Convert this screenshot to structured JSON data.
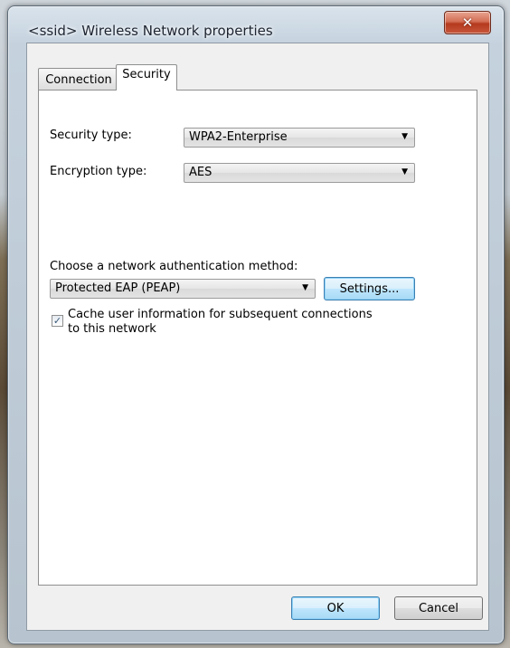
{
  "window": {
    "title": "<ssid> Wireless Network properties",
    "close_icon": "close-icon"
  },
  "tabs": [
    {
      "label": "Connection",
      "selected": false
    },
    {
      "label": "Security",
      "selected": true
    }
  ],
  "security": {
    "security_type_label": "Security type:",
    "security_type_value": "WPA2-Enterprise",
    "encryption_type_label": "Encryption type:",
    "encryption_type_value": "AES",
    "auth_method_label": "Choose a network authentication method:",
    "auth_method_value": "Protected EAP (PEAP)",
    "settings_label": "Settings...",
    "cache_checkbox_checked": true,
    "cache_label_line1": "Cache user information for subsequent connections",
    "cache_label_line2": "to this network"
  },
  "footer": {
    "ok_label": "OK",
    "cancel_label": "Cancel"
  },
  "colors": {
    "accent_focus": "#3c7fb1",
    "close_button": "#c7573c"
  }
}
